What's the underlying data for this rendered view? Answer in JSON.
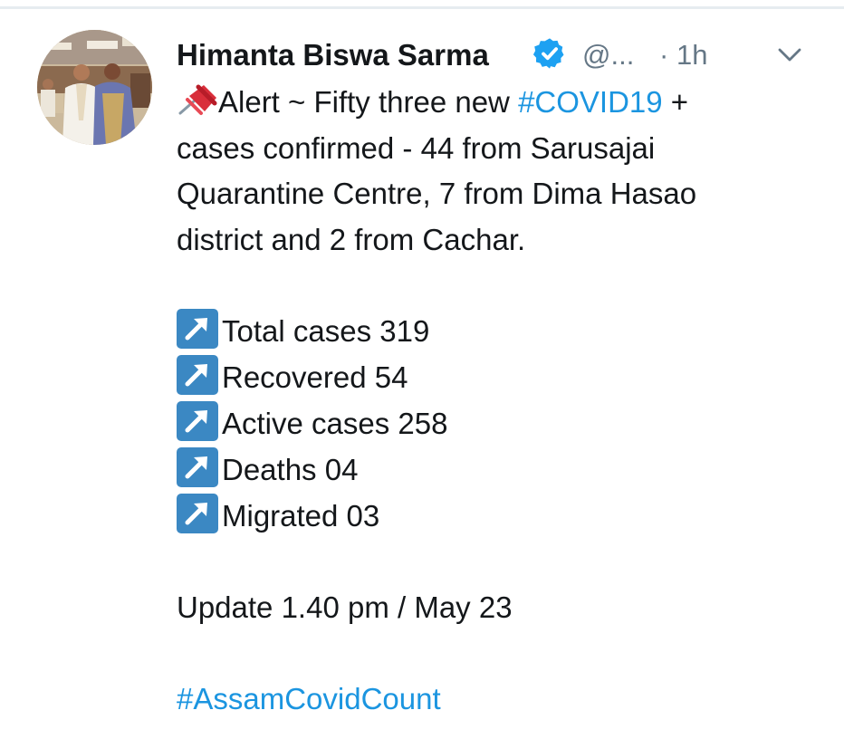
{
  "tweet": {
    "author_name": "Himanta Biswa Sarma",
    "handle": "@...",
    "time_separator": "·",
    "time": "1h",
    "verified_icon": "verified-badge-icon",
    "caret_icon": "chevron-down-icon",
    "pin_icon": "pushpin-icon",
    "arrow_icon": "up-right-arrow-icon",
    "alert_prefix": "Alert ~  Fifty three new ",
    "alert_hashtag": "#COVID19",
    "alert_suffix": " +",
    "body_lines": [
      "cases confirmed - 44 from Sarusajai",
      "Quarantine Centre, 7 from Dima Hasao",
      "district and 2 from Cachar."
    ],
    "stats": [
      "Total cases 319",
      "Recovered 54",
      "Active cases 258",
      "Deaths 04",
      "Migrated 03"
    ],
    "update_line": "Update 1.40 pm / May 23",
    "footer_hashtag": "#AssamCovidCount",
    "colors": {
      "text": "#14171a",
      "muted": "#657786",
      "link": "#1b95e0",
      "verified": "#1da1f2",
      "arrow_box": "#3b88c3",
      "divider": "#e6ecf0"
    }
  }
}
